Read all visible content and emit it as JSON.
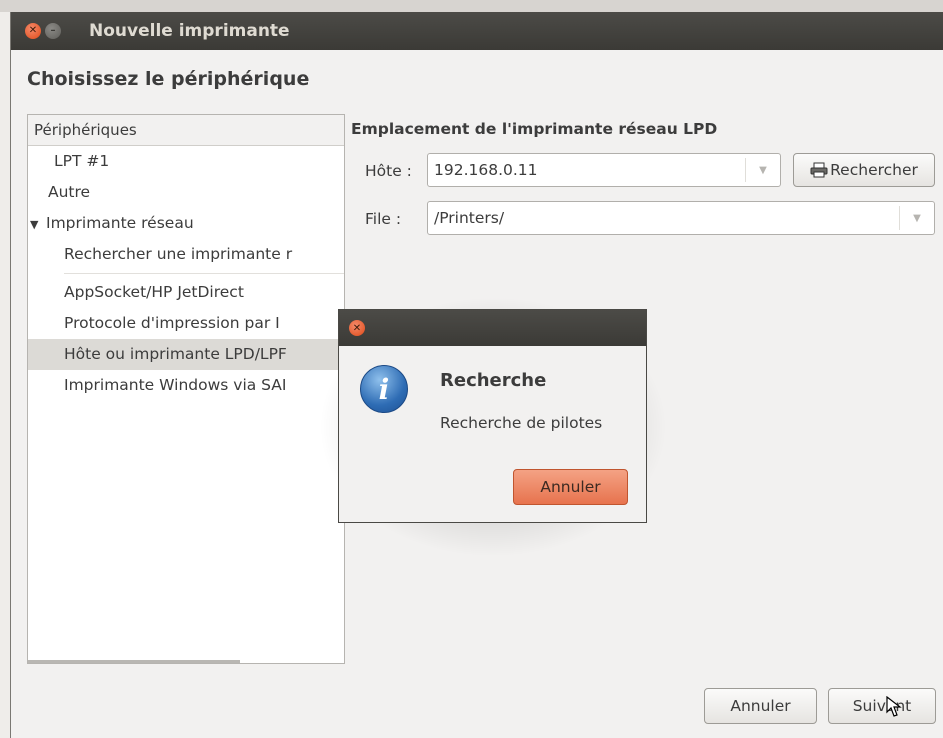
{
  "window": {
    "title": "Nouvelle imprimante",
    "heading": "Choisissez le périphérique"
  },
  "devices": {
    "header": "Périphériques",
    "items": [
      {
        "label": "LPT #1"
      },
      {
        "label": "Autre"
      },
      {
        "label": "Imprimante réseau",
        "expanded": true
      },
      {
        "label": "Rechercher une imprimante r"
      },
      {
        "label": "AppSocket/HP JetDirect"
      },
      {
        "label": "Protocole d'impression par I"
      },
      {
        "label": "Hôte ou imprimante LPD/LPF",
        "selected": true
      },
      {
        "label": "Imprimante Windows via SAI"
      }
    ]
  },
  "location": {
    "title": "Emplacement de l'imprimante réseau LPD",
    "host_label": "Hôte :",
    "host_value": "192.168.0.11",
    "search_button": "Rechercher",
    "queue_label": "File :",
    "queue_value": "/Printers/"
  },
  "footer": {
    "cancel": "Annuler",
    "next": "Suivant"
  },
  "dialog": {
    "title": "Recherche",
    "message": "Recherche de pilotes",
    "cancel": "Annuler"
  },
  "icons": {
    "close": "close-icon",
    "minimize": "minimize-icon",
    "info": "info-icon",
    "printer": "printer-icon",
    "expander": "expander-down-icon",
    "combo_arrow": "chevron-down-icon"
  }
}
